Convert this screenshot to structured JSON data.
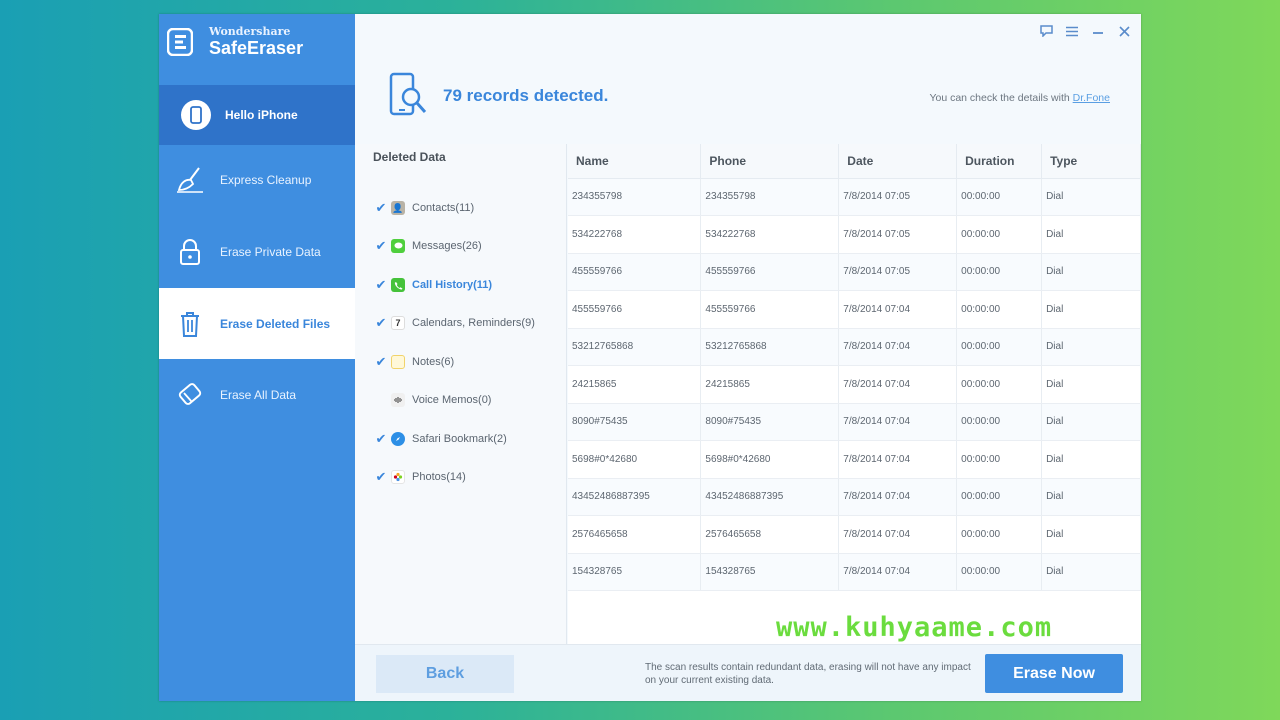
{
  "brand": {
    "sub": "Wondershare",
    "name": "SafeEraser"
  },
  "sidebar": {
    "hello": "Hello iPhone",
    "items": [
      {
        "label": "Express Cleanup"
      },
      {
        "label": "Erase Private Data"
      },
      {
        "label": "Erase Deleted Files"
      },
      {
        "label": "Erase All Data"
      }
    ]
  },
  "header": {
    "records": "79 records detected.",
    "check_text": "You can check the details with ",
    "check_link": "Dr.Fone"
  },
  "categories": {
    "title": "Deleted Data",
    "items": [
      {
        "label": "Contacts(11)",
        "checked": true
      },
      {
        "label": "Messages(26)",
        "checked": true
      },
      {
        "label": "Call History(11)",
        "checked": true
      },
      {
        "label": "Calendars, Reminders(9)",
        "checked": true
      },
      {
        "label": "Notes(6)",
        "checked": true
      },
      {
        "label": "Voice Memos(0)",
        "checked": false
      },
      {
        "label": "Safari Bookmark(2)",
        "checked": true
      },
      {
        "label": "Photos(14)",
        "checked": true
      }
    ]
  },
  "table": {
    "headers": [
      "Name",
      "Phone",
      "Date",
      "Duration",
      "Type"
    ],
    "rows": [
      [
        "234355798",
        "234355798",
        "7/8/2014 07:05",
        "00:00:00",
        "Dial"
      ],
      [
        "534222768",
        "534222768",
        "7/8/2014 07:05",
        "00:00:00",
        "Dial"
      ],
      [
        "455559766",
        "455559766",
        "7/8/2014 07:05",
        "00:00:00",
        "Dial"
      ],
      [
        "455559766",
        "455559766",
        "7/8/2014 07:04",
        "00:00:00",
        "Dial"
      ],
      [
        "53212765868",
        "53212765868",
        "7/8/2014 07:04",
        "00:00:00",
        "Dial"
      ],
      [
        "24215865",
        "24215865",
        "7/8/2014 07:04",
        "00:00:00",
        "Dial"
      ],
      [
        "8090#75435",
        "8090#75435",
        "7/8/2014 07:04",
        "00:00:00",
        "Dial"
      ],
      [
        "5698#0*42680",
        "5698#0*42680",
        "7/8/2014 07:04",
        "00:00:00",
        "Dial"
      ],
      [
        "43452486887395",
        "43452486887395",
        "7/8/2014 07:04",
        "00:00:00",
        "Dial"
      ],
      [
        "2576465658",
        "2576465658",
        "7/8/2014 07:04",
        "00:00:00",
        "Dial"
      ],
      [
        "154328765",
        "154328765",
        "7/8/2014 07:04",
        "00:00:00",
        "Dial"
      ]
    ]
  },
  "footer": {
    "back": "Back",
    "note": "The scan results contain redundant data, erasing will not have any impact on your current existing data.",
    "erase": "Erase Now"
  },
  "watermark": "www.kuhyaame.com",
  "colors": {
    "accent": "#3f8ee0",
    "sidebar_active": "#2f73c9",
    "check": "#3a86db"
  }
}
